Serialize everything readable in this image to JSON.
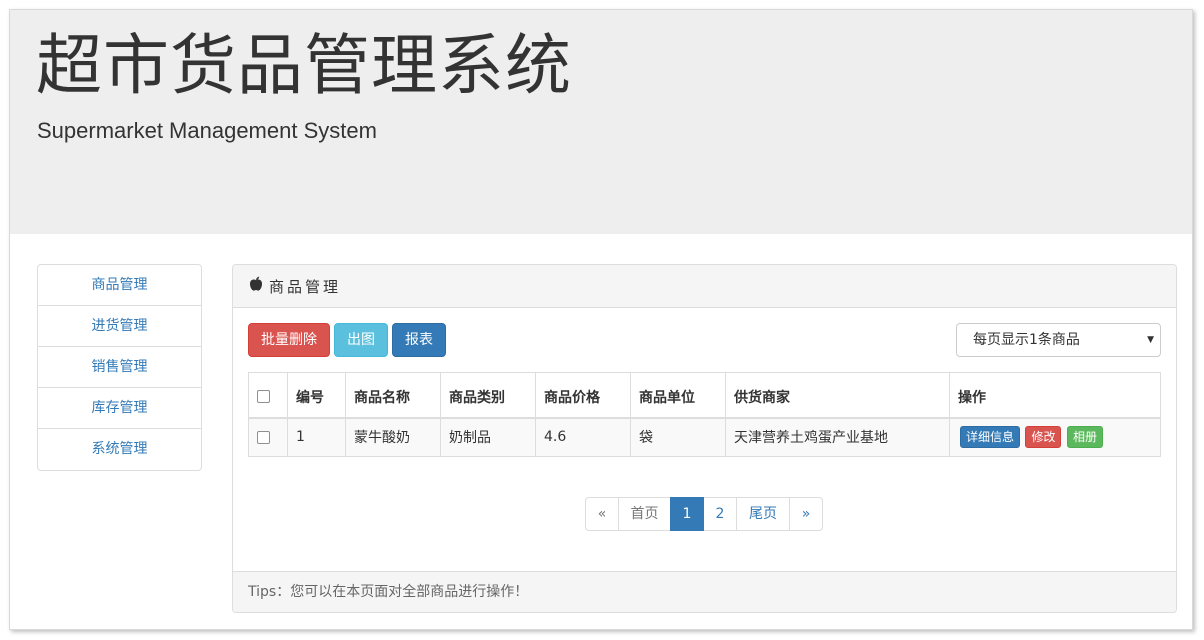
{
  "header": {
    "title": "超市货品管理系统",
    "subtitle": "Supermarket Management System"
  },
  "sidebar": {
    "items": [
      {
        "label": "商品管理"
      },
      {
        "label": "进货管理"
      },
      {
        "label": "销售管理"
      },
      {
        "label": "库存管理"
      },
      {
        "label": "系统管理"
      }
    ]
  },
  "panel": {
    "title": "商品管理",
    "icon": "apple-icon",
    "toolbar": {
      "batch_delete_label": "批量删除",
      "chart_label": "出图",
      "report_label": "报表"
    },
    "page_size_select": {
      "selected": "每页显示1条商品",
      "options": [
        "每页显示1条商品"
      ]
    },
    "table": {
      "headers": [
        "编号",
        "商品名称",
        "商品类别",
        "商品价格",
        "商品单位",
        "供货商家",
        "操作"
      ],
      "rows": [
        {
          "id": "1",
          "name": "蒙牛酸奶",
          "category": "奶制品",
          "price": "4.6",
          "unit": "袋",
          "supplier": "天津营养土鸡蛋产业基地",
          "actions": {
            "detail": "详细信息",
            "edit": "修改",
            "album": "相册"
          }
        }
      ]
    },
    "pagination": {
      "prev": "«",
      "first": "首页",
      "pages": [
        "1",
        "2"
      ],
      "current_page": "1",
      "last": "尾页",
      "next": "»"
    },
    "footer_tip": "Tips：您可以在本页面对全部商品进行操作！"
  },
  "colors": {
    "jumbotron_bg": "#eeeeee",
    "primary": "#337ab7",
    "danger": "#d9534f",
    "info": "#5bc0de",
    "success": "#5cb85c"
  }
}
